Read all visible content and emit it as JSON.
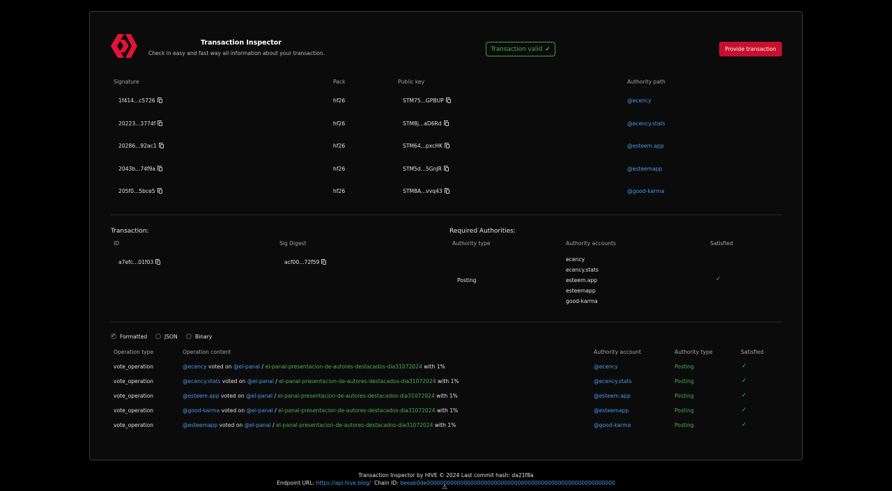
{
  "header": {
    "title": "Transaction Inspector",
    "subtitle": "Check in easy and fast way all information about your transaction.",
    "valid_label": "Transaction valid",
    "provide_label": "Provide transaction"
  },
  "signatures": {
    "headers": [
      "Signature",
      "Pack",
      "Public key",
      "Authority path"
    ],
    "rows": [
      {
        "signature": "1f414...c5726",
        "pack": "hf26",
        "public_key": "STM75...GPBUP",
        "authority": "@ecency"
      },
      {
        "signature": "20223...3774f",
        "pack": "hf26",
        "public_key": "STM8j...aD6Rd",
        "authority": "@ecency.stats"
      },
      {
        "signature": "20286...92ac1",
        "pack": "hf26",
        "public_key": "STM64...pxcHK",
        "authority": "@esteem.app"
      },
      {
        "signature": "2043b...74f9a",
        "pack": "hf26",
        "public_key": "STM5d...5GnJR",
        "authority": "@esteemapp"
      },
      {
        "signature": "205f0...5bce5",
        "pack": "hf26",
        "public_key": "STM8A...vvq43",
        "authority": "@good-karma"
      }
    ]
  },
  "transaction": {
    "label": "Transaction:",
    "id_header": "ID",
    "digest_header": "Sig Digest",
    "id": "a7efc...01f03",
    "digest": "acf00...72f59"
  },
  "authorities": {
    "label": "Required Authorities:",
    "headers": [
      "Authority type",
      "Authority accounts",
      "Satisfied"
    ],
    "type": "Posting",
    "accounts": [
      "ecency",
      "ecency.stats",
      "esteem.app",
      "esteemapp",
      "good-karma"
    ],
    "satisfied": "✓"
  },
  "format": {
    "options": [
      "Formatted",
      "JSON",
      "Binary"
    ],
    "selected": "Formatted"
  },
  "operations": {
    "headers": [
      "Operation type",
      "Operation content",
      "Authority account",
      "Authority type",
      "Satisfied"
    ],
    "rows": [
      {
        "type": "vote_operation",
        "voter": "@ecency",
        "voted_on": "voted on",
        "author": "@el-panal",
        "sep": "/",
        "permlink": "el-panal-presentacion-de-autores-destacados-dia31072024",
        "weight": "with 1%",
        "account": "@ecency",
        "auth_type": "Posting",
        "satisfied": "✓"
      },
      {
        "type": "vote_operation",
        "voter": "@ecency.stats",
        "voted_on": "voted on",
        "author": "@el-panal",
        "sep": "/",
        "permlink": "el-panal-presentacion-de-autores-destacados-dia31072024",
        "weight": "with 1%",
        "account": "@ecency.stats",
        "auth_type": "Posting",
        "satisfied": "✓"
      },
      {
        "type": "vote_operation",
        "voter": "@esteem.app",
        "voted_on": "voted on",
        "author": "@el-panal",
        "sep": "/",
        "permlink": "el-panal-presentacion-de-autores-destacados-dia31072024",
        "weight": "with 1%",
        "account": "@esteem.app",
        "auth_type": "Posting",
        "satisfied": "✓"
      },
      {
        "type": "vote_operation",
        "voter": "@good-karma",
        "voted_on": "voted on",
        "author": "@el-panal",
        "sep": "/",
        "permlink": "el-panal-presentacion-de-autores-destacados-dia31072024",
        "weight": "with 1%",
        "account": "@esteemapp",
        "auth_type": "Posting",
        "satisfied": "✓"
      },
      {
        "type": "vote_operation",
        "voter": "@esteemapp",
        "voted_on": "voted on",
        "author": "@el-panal",
        "sep": "/",
        "permlink": "el-panal-presentacion-de-autores-destacados-dia31072024",
        "weight": "with 1%",
        "account": "@good-karma",
        "auth_type": "Posting",
        "satisfied": "✓"
      }
    ]
  },
  "footer": {
    "line1": "Transaction Inspector by HIVE © 2024   Last commit hash: da21f8a",
    "endpoint_label": "Endpoint URL:",
    "endpoint": "https://api.hive.blog/",
    "chain_label": "Chain ID:",
    "chain_id": "beeab0de00000000000000000000000000000000000000000000000000000000"
  },
  "colors": {
    "accent": "#c8102e",
    "link": "#4a9ae8",
    "ok": "#4caf50"
  }
}
